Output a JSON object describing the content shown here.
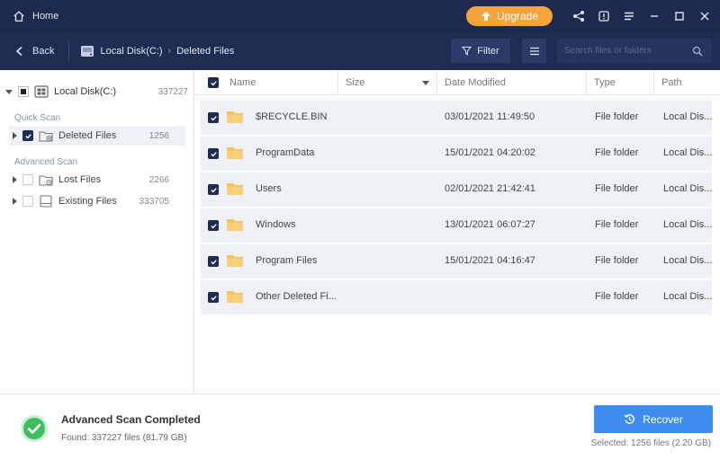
{
  "titlebar": {
    "home_label": "Home",
    "upgrade_label": "Upgrade"
  },
  "navbar": {
    "back_label": "Back",
    "crumbs": [
      "Local Disk(C:)",
      "Deleted Files"
    ],
    "filter_label": "Filter",
    "search_placeholder": "Search files or folders"
  },
  "sidebar": {
    "root": {
      "label": "Local Disk(C:)",
      "count": "337227"
    },
    "quick_scan_label": "Quick Scan",
    "advanced_scan_label": "Advanced Scan",
    "items": [
      {
        "label": "Deleted Files",
        "count": "1256",
        "checked": true,
        "selected": true
      },
      {
        "label": "Lost Files",
        "count": "2266",
        "checked": false,
        "selected": false
      },
      {
        "label": "Existing Files",
        "count": "333705",
        "checked": false,
        "selected": false
      }
    ]
  },
  "table": {
    "columns": [
      "Name",
      "Size",
      "Date Modified",
      "Type",
      "Path"
    ],
    "rows": [
      {
        "name": "$RECYCLE.BIN",
        "size": "",
        "date": "03/01/2021 11:49:50",
        "type": "File folder",
        "path": "Local Dis..."
      },
      {
        "name": "ProgramData",
        "size": "",
        "date": "15/01/2021 04:20:02",
        "type": "File folder",
        "path": "Local Dis..."
      },
      {
        "name": "Users",
        "size": "",
        "date": "02/01/2021 21:42:41",
        "type": "File folder",
        "path": "Local Dis..."
      },
      {
        "name": "Windows",
        "size": "",
        "date": "13/01/2021 06:07:27",
        "type": "File folder",
        "path": "Local Dis..."
      },
      {
        "name": "Program Files",
        "size": "",
        "date": "15/01/2021 04:16:47",
        "type": "File folder",
        "path": "Local Dis..."
      },
      {
        "name": "Other Deleted Fi...",
        "size": "",
        "date": "",
        "type": "File folder",
        "path": "Local Dis..."
      }
    ]
  },
  "footer": {
    "status_title": "Advanced Scan Completed",
    "status_sub": "Found: 337227 files (81.79 GB)",
    "recover_label": "Recover",
    "selected_info": "Selected: 1256 files (2.20 GB)"
  },
  "colors": {
    "titlebar": "#1d2a4d",
    "navbar": "#1f2c52",
    "upgrade": "#f5a33b",
    "recover": "#3d8cf0",
    "folder": "#f6c05a",
    "success": "#3cbf5c"
  }
}
